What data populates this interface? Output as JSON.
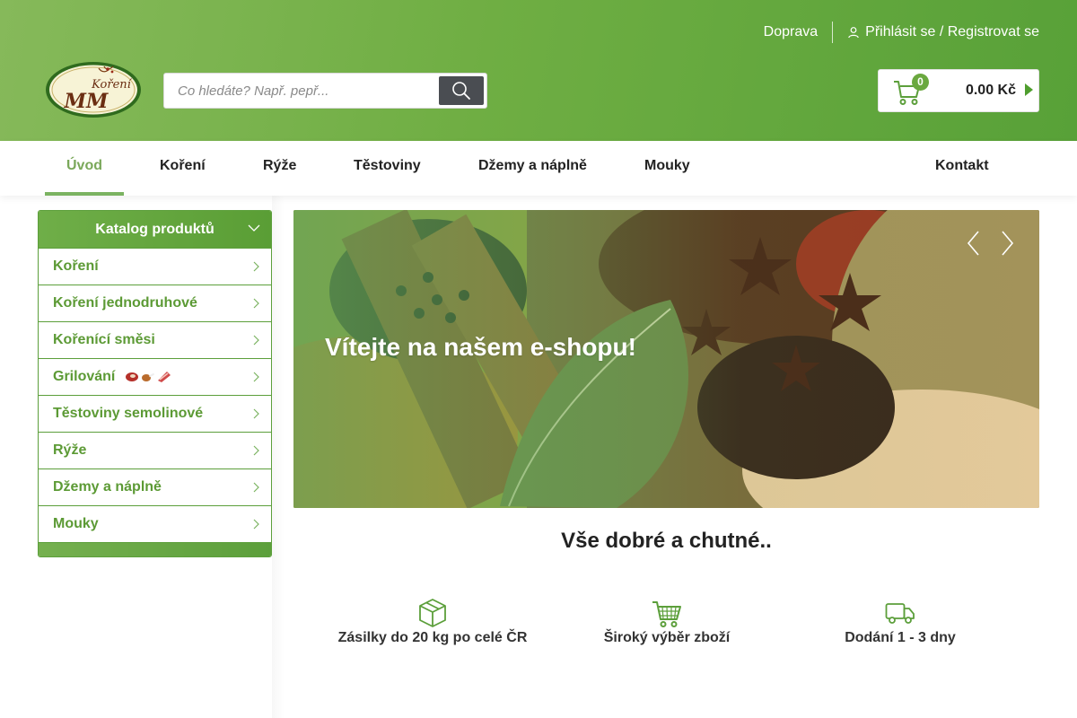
{
  "header": {
    "links": {
      "shipping": "Doprava",
      "login": "Přihlásit se / Registrovat se"
    },
    "logo": {
      "text_top": "Koření",
      "text_monogram": "MM"
    },
    "search": {
      "placeholder": "Co hledáte? Např. pepř...",
      "value": ""
    },
    "cart": {
      "count": "0",
      "total": "0.00 Kč"
    }
  },
  "nav": {
    "items": [
      {
        "label": "Úvod",
        "active": true
      },
      {
        "label": "Koření"
      },
      {
        "label": "Rýže"
      },
      {
        "label": "Těstoviny"
      },
      {
        "label": "Džemy a náplně"
      },
      {
        "label": "Mouky"
      },
      {
        "label": "Kontakt"
      }
    ]
  },
  "sidebar": {
    "title": "Katalog produktů",
    "items": [
      {
        "label": "Koření"
      },
      {
        "label": "Koření jednodruhové"
      },
      {
        "label": "Kořenící směsi"
      },
      {
        "label": "Grilování"
      },
      {
        "label": "Těstoviny semolinové"
      },
      {
        "label": "Rýže"
      },
      {
        "label": "Džemy a náplně"
      },
      {
        "label": "Mouky"
      }
    ]
  },
  "banner": {
    "headline": "Vítejte na našem e-shopu!"
  },
  "main": {
    "tagline": "Vše dobré a chutné..",
    "features": [
      {
        "icon": "box-icon",
        "label": "Zásilky do 20 kg po celé ČR"
      },
      {
        "icon": "shopping-cart-icon",
        "label": "Široký výběr zboží"
      },
      {
        "icon": "delivery-truck-icon",
        "label": "Dodání 1 - 3 dny"
      }
    ]
  },
  "colors": {
    "brand_green": "#5c9f3b",
    "accent_green": "#7bb361",
    "dark_button": "#4a4d52"
  }
}
